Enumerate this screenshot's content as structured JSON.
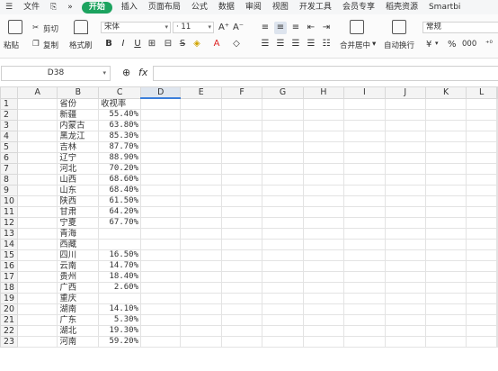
{
  "menu": {
    "file": "文件",
    "items": [
      "开始",
      "插入",
      "页面布局",
      "公式",
      "数据",
      "审阅",
      "视图",
      "开发工具",
      "会员专享",
      "稻壳资源",
      "Smartbi"
    ]
  },
  "ribbon": {
    "paste": "粘贴",
    "cut": "剪切",
    "copy": "复制",
    "format_painter": "格式刷",
    "font_name": "宋体",
    "font_size": "11",
    "bold": "B",
    "italic": "I",
    "underline": "U",
    "merge_center": "合并居中",
    "wrap_text": "自动换行",
    "number_format": "常规",
    "currency": "¥",
    "percent": "%",
    "thousands": "000"
  },
  "formula_bar": {
    "name_box": "D38",
    "fx": "fx"
  },
  "sheet": {
    "columns": [
      "A",
      "B",
      "C",
      "D",
      "E",
      "F",
      "G",
      "H",
      "I",
      "J",
      "K",
      "L"
    ],
    "rows": [
      {
        "n": "1",
        "b": "省份",
        "c": "收视率"
      },
      {
        "n": "2",
        "b": "新疆",
        "c": "55.40%"
      },
      {
        "n": "3",
        "b": "内蒙古",
        "c": "63.80%"
      },
      {
        "n": "4",
        "b": "黑龙江",
        "c": "85.30%"
      },
      {
        "n": "5",
        "b": "吉林",
        "c": "87.70%"
      },
      {
        "n": "6",
        "b": "辽宁",
        "c": "88.90%"
      },
      {
        "n": "7",
        "b": "河北",
        "c": "70.20%"
      },
      {
        "n": "8",
        "b": "山西",
        "c": "68.60%"
      },
      {
        "n": "9",
        "b": "山东",
        "c": "68.40%"
      },
      {
        "n": "10",
        "b": "陕西",
        "c": "61.50%"
      },
      {
        "n": "11",
        "b": "甘肃",
        "c": "64.20%"
      },
      {
        "n": "12",
        "b": "宁夏",
        "c": "67.70%"
      },
      {
        "n": "13",
        "b": "青海",
        "c": ""
      },
      {
        "n": "14",
        "b": "西藏",
        "c": ""
      },
      {
        "n": "15",
        "b": "四川",
        "c": "16.50%"
      },
      {
        "n": "16",
        "b": "云南",
        "c": "14.70%"
      },
      {
        "n": "17",
        "b": "贵州",
        "c": "18.40%"
      },
      {
        "n": "18",
        "b": "广西",
        "c": "2.60%"
      },
      {
        "n": "19",
        "b": "重庆",
        "c": ""
      },
      {
        "n": "20",
        "b": "湖南",
        "c": "14.10%"
      },
      {
        "n": "21",
        "b": "广东",
        "c": "5.30%"
      },
      {
        "n": "22",
        "b": "湖北",
        "c": "19.30%"
      },
      {
        "n": "23",
        "b": "河南",
        "c": "59.20%"
      }
    ]
  },
  "colors": {
    "accent": "#1ca35f",
    "selection": "#3a7edb"
  }
}
